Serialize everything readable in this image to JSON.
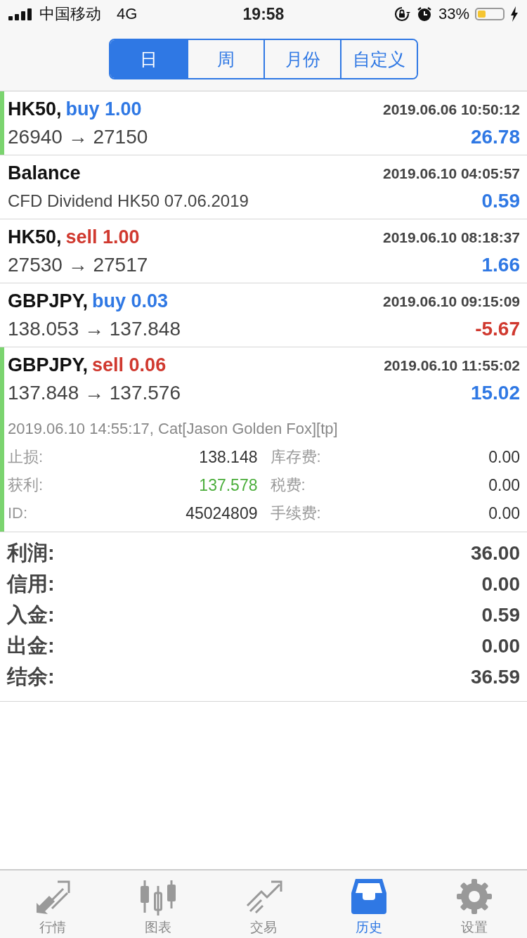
{
  "status_bar": {
    "carrier": "中国移动",
    "network": "4G",
    "time": "19:58",
    "battery": "33%"
  },
  "period_tabs": [
    {
      "label": "日",
      "selected": true
    },
    {
      "label": "周",
      "selected": false
    },
    {
      "label": "月份",
      "selected": false
    },
    {
      "label": "自定义",
      "selected": false
    }
  ],
  "deals": [
    {
      "kind": "trade",
      "symbol": "HK50,",
      "side": "buy",
      "volume": "1.00",
      "color": "#2f78e4",
      "time": "2019.06.06 10:50:12",
      "detail": "26940 → 27150",
      "profit": "26.78",
      "loss": false,
      "highlighted": true
    },
    {
      "kind": "balance",
      "symbol": "Balance",
      "time": "2019.06.10 04:05:57",
      "detail": "CFD Dividend HK50 07.06.2019",
      "profit": "0.59",
      "loss": false,
      "highlighted": false
    },
    {
      "kind": "trade",
      "symbol": "HK50,",
      "side": "sell",
      "volume": "1.00",
      "color": "#d0392f",
      "time": "2019.06.10 08:18:37",
      "detail": "27530 → 27517",
      "profit": "1.66",
      "loss": false,
      "highlighted": false
    },
    {
      "kind": "trade",
      "symbol": "GBPJPY,",
      "side": "buy",
      "volume": "0.03",
      "color": "#2f78e4",
      "time": "2019.06.10 09:15:09",
      "detail": "138.053 → 137.848",
      "profit": "-5.67",
      "loss": true,
      "highlighted": false
    },
    {
      "kind": "trade",
      "symbol": "GBPJPY,",
      "side": "sell",
      "volume": "0.06",
      "color": "#d0392f",
      "time": "2019.06.10 11:55:02",
      "detail": "137.848 → 137.576",
      "profit": "15.02",
      "loss": false,
      "highlighted": true,
      "expanded": {
        "comment": "2019.06.10 14:55:17, Cat[Jason Golden Fox][tp]",
        "fields": [
          {
            "label": "止损:",
            "value": "138.148",
            "kind": "plain"
          },
          {
            "label": "库存费:",
            "value": "0.00",
            "kind": "plain"
          },
          {
            "label": "获利:",
            "value": "137.578",
            "kind": "take_profit"
          },
          {
            "label": "税费:",
            "value": "0.00",
            "kind": "plain"
          },
          {
            "label": "ID:",
            "value": "45024809",
            "kind": "plain"
          },
          {
            "label": "手续费:",
            "value": "0.00",
            "kind": "plain"
          }
        ]
      }
    }
  ],
  "summary": [
    {
      "label": "利润:",
      "value": "36.00"
    },
    {
      "label": "信用:",
      "value": "0.00"
    },
    {
      "label": "入金:",
      "value": "0.59"
    },
    {
      "label": "出金:",
      "value": "0.00"
    },
    {
      "label": "结余:",
      "value": "36.59"
    }
  ],
  "tab_bar": [
    {
      "label": "行情",
      "selected": false
    },
    {
      "label": "图表",
      "selected": false
    },
    {
      "label": "交易",
      "selected": false
    },
    {
      "label": "历史",
      "selected": true
    },
    {
      "label": "设置",
      "selected": false
    }
  ]
}
